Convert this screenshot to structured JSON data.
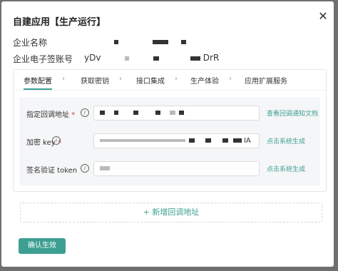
{
  "modal": {
    "title": "自建应用【生产运行】",
    "close_symbol": "✕"
  },
  "info": {
    "company_name_label": "企业名称",
    "account_label": "企业电子签账号",
    "account_value_start": "yDv",
    "account_value_end": "DrR"
  },
  "tabs": [
    {
      "label": "参数配置"
    },
    {
      "label": "获取密钥"
    },
    {
      "label": "接口集成"
    },
    {
      "label": "生产体验"
    },
    {
      "label": "应用扩展服务"
    }
  ],
  "form": {
    "callback_label": "指定回调地址",
    "callback_link": "查看回调通知文档",
    "key_label": "加密 key",
    "key_value_end": "IA",
    "key_link": "点击系统生成",
    "token_label": "签名验证 token",
    "token_link": "点击系统生成",
    "required_mark": "*",
    "info_glyph": "i"
  },
  "add_callback": {
    "plus": "+",
    "label": "新增回调地址"
  },
  "confirm_button": "确认生效",
  "colors": {
    "accent": "#3d9f93",
    "required": "#e23a3a"
  }
}
